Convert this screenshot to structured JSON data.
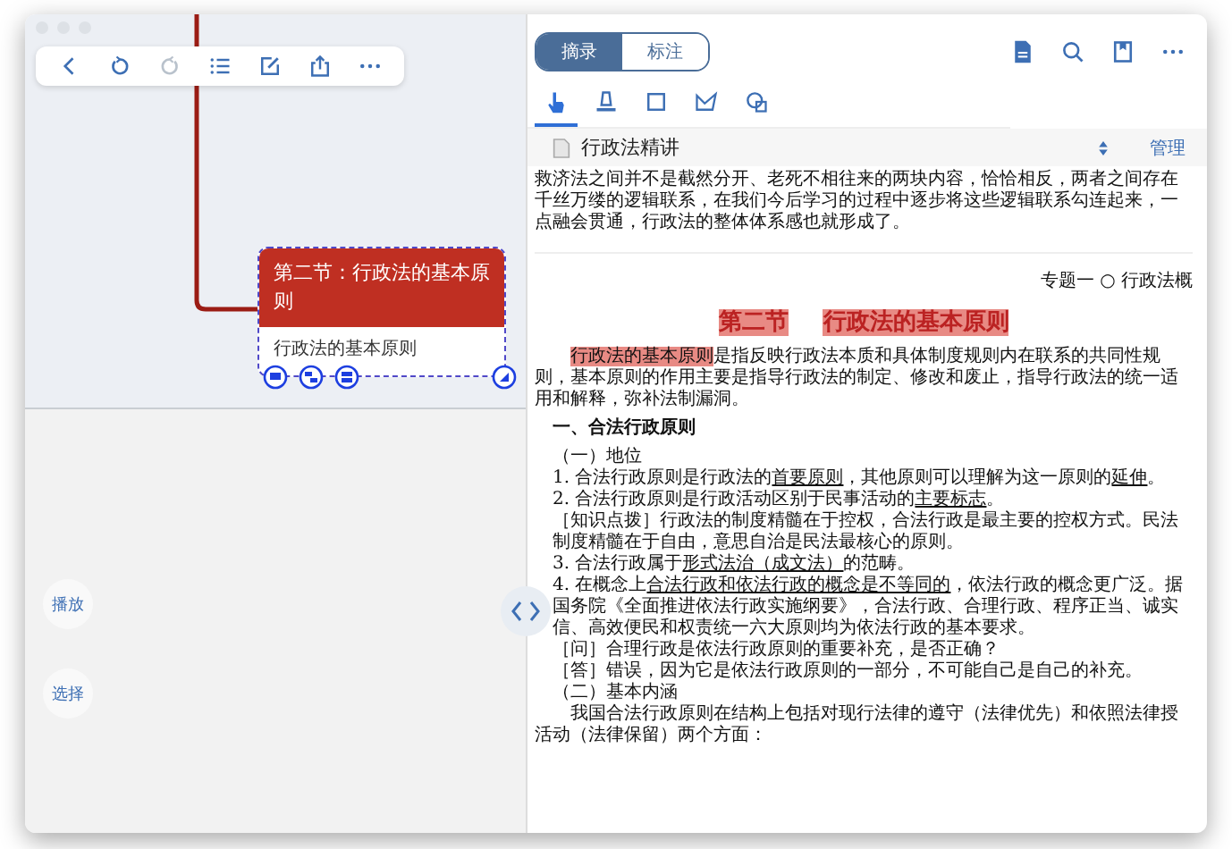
{
  "mindmap": {
    "node": {
      "title": "第二节：行政法的基本原则",
      "subtitle": "行政法的基本原则"
    }
  },
  "side_buttons": [
    "播放",
    "选择"
  ],
  "reader": {
    "tabs": [
      {
        "label": "摘录",
        "selected": true
      },
      {
        "label": "标注",
        "selected": false
      }
    ],
    "tools": [
      {
        "kind": "pointer",
        "selected": true
      },
      {
        "kind": "highlighter",
        "selected": false
      },
      {
        "kind": "rectangle",
        "selected": false
      },
      {
        "kind": "lasso",
        "selected": false
      },
      {
        "kind": "stamp",
        "selected": false
      }
    ],
    "document": {
      "title": "行政法精讲",
      "action": "管理",
      "blocks": [
        {
          "kind": "intro",
          "text": "救济法之间并不是截然分开、老死不相往来的两块内容，恰恰相反，两者之间存在千丝万缕的逻辑联系，在我们今后学习的过程中逐步将这些逻辑联系勾连起来，一点融会贯通，行政法的整体体系感也就形成了。"
        },
        {
          "kind": "running_header",
          "text": "专题一 ○ 行政法概"
        },
        {
          "kind": "title",
          "segments": [
            {
              "text": "第二节",
              "highlighted": true,
              "underlined": false
            },
            {
              "text": "行政法的基本原则",
              "highlighted": true,
              "underlined": false
            }
          ]
        },
        {
          "kind": "para",
          "segments": [
            {
              "text": "行政法的基本原则",
              "highlighted": true,
              "underlined": false
            },
            {
              "text": "是指反映行政法本质和具体制度规则内在联系的共同性规则，基本原则的作用主要是指导行政法的制定、修改和废止，指导行政法的统一适用和解释，弥补法制漏洞。",
              "highlighted": false,
              "underlined": false
            }
          ]
        },
        {
          "kind": "heading",
          "text": "一、合法行政原则"
        },
        {
          "kind": "item",
          "text": "（一）地位"
        },
        {
          "kind": "item",
          "segments": [
            {
              "text": "1. 合法行政原则是行政法的",
              "highlighted": false,
              "underlined": false
            },
            {
              "text": "首要原则",
              "highlighted": false,
              "underlined": true
            },
            {
              "text": "，其他原则可以理解为这一原则的",
              "highlighted": false,
              "underlined": false
            },
            {
              "text": "延伸",
              "highlighted": false,
              "underlined": true
            },
            {
              "text": "。",
              "highlighted": false,
              "underlined": false
            }
          ]
        },
        {
          "kind": "item",
          "segments": [
            {
              "text": "2. 合法行政原则是行政活动区别于民事活动的",
              "highlighted": false,
              "underlined": false
            },
            {
              "text": "主要标志",
              "highlighted": false,
              "underlined": true
            },
            {
              "text": "。",
              "highlighted": false,
              "underlined": false
            }
          ]
        },
        {
          "kind": "item",
          "text": "［知识点拨］行政法的制度精髓在于控权，合法行政是最主要的控权方式。民法制度精髓在于自由，意思自治是民法最核心的原则。"
        },
        {
          "kind": "item",
          "segments": [
            {
              "text": "3. 合法行政属于",
              "highlighted": false,
              "underlined": false
            },
            {
              "text": "形式法治（成文法）",
              "highlighted": false,
              "underlined": true
            },
            {
              "text": "的范畴。",
              "highlighted": false,
              "underlined": false
            }
          ]
        },
        {
          "kind": "item",
          "segments": [
            {
              "text": "4. 在概念上",
              "highlighted": false,
              "underlined": false
            },
            {
              "text": "合法行政和依法行政的概念是不等同的",
              "highlighted": false,
              "underlined": true
            },
            {
              "text": "，依法行政的概念更广泛。据国务院《全面推进依法行政实施纲要》，合法行政、合理行政、程序正当、诚实信、高效便民和权责统一六大原则均为依法行政的基本要求。",
              "highlighted": false,
              "underlined": false
            }
          ]
        },
        {
          "kind": "item",
          "text": "［问］合理行政是依法行政原则的重要补充，是否正确？"
        },
        {
          "kind": "item",
          "text": "［答］错误，因为它是依法行政原则的一部分，不可能自己是自己的补充。"
        },
        {
          "kind": "item",
          "text": "（二）基本内涵"
        },
        {
          "kind": "para",
          "text": "我国合法行政原则在结构上包括对现行法律的遵守（法律优先）和依照法律授活动（法律保留）两个方面："
        }
      ]
    }
  }
}
